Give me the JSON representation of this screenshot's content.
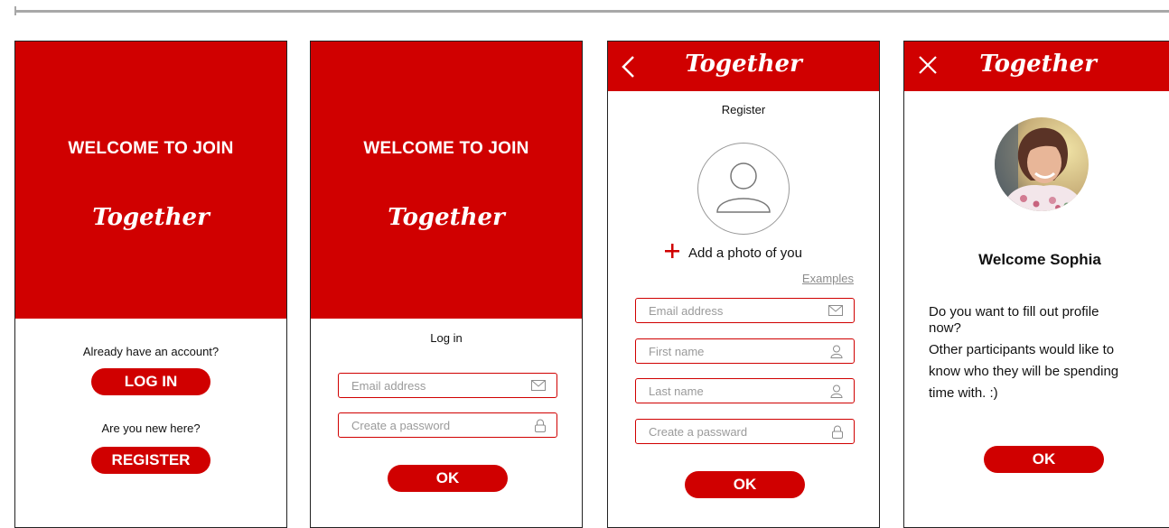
{
  "colors": {
    "brand_red": "#d00000",
    "field_text": "#9a9a9a",
    "frame_border": "#222222"
  },
  "screen1": {
    "hero_title": "WELCOME TO JOIN",
    "brand": "Together",
    "login_prompt": "Already have an account?",
    "login_button": "LOG IN",
    "register_prompt": "Are you new here?",
    "register_button": "REGISTER"
  },
  "screen2": {
    "hero_title": "WELCOME TO JOIN",
    "brand": "Together",
    "heading": "Log in",
    "email_placeholder": "Email address",
    "email_icon": "envelope-icon",
    "password_placeholder": "Create a password",
    "password_icon": "lock-icon",
    "ok_button": "OK"
  },
  "screen3": {
    "back_icon": "chevron-left-icon",
    "brand": "Together",
    "heading": "Register",
    "avatar_icon": "user-placeholder-icon",
    "add_photo_icon": "plus-icon",
    "add_photo_label": "Add a photo of you",
    "examples_link": "Examples",
    "fields": [
      {
        "placeholder": "Email address",
        "icon": "envelope-icon"
      },
      {
        "placeholder": "First name",
        "icon": "person-icon"
      },
      {
        "placeholder": "Last name",
        "icon": "person-icon"
      },
      {
        "placeholder": "Create a passward",
        "icon": "lock-icon"
      }
    ],
    "ok_button": "OK"
  },
  "screen4": {
    "close_icon": "close-icon",
    "brand": "Together",
    "profile_photo": "profile-photo",
    "welcome_heading": "Welcome Sophia",
    "message_line1": "Do you want to fill out profile",
    "message_line2": "now?",
    "message_line3": "Other participants would like to",
    "message_line4": "know who they will be spending",
    "message_line5": "time with. :)",
    "ok_button": "OK"
  }
}
